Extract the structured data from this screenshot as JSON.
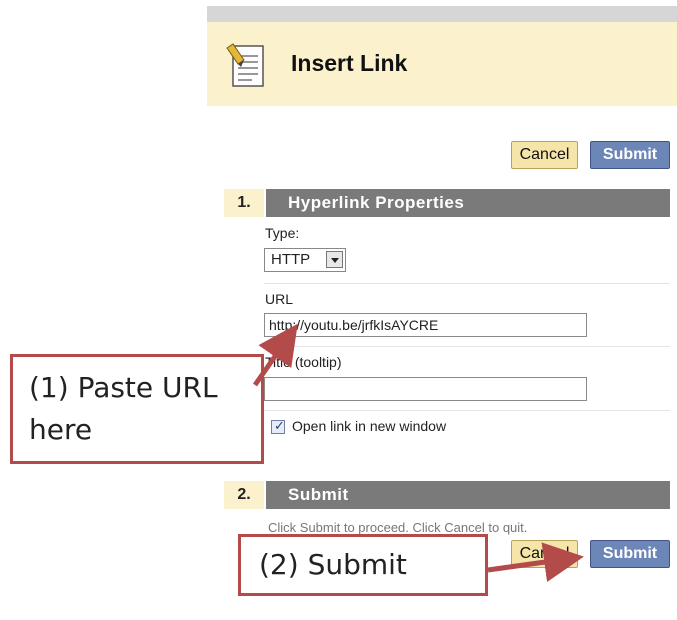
{
  "page": {
    "title": "Insert Link"
  },
  "actions": {
    "cancel_label": "Cancel",
    "submit_label": "Submit"
  },
  "section1": {
    "number": "1.",
    "title": "Hyperlink Properties",
    "type_label": "Type:",
    "type_value": "HTTP",
    "url_label": "URL",
    "url_value": "http://youtu.be/jrfkIsAYCRE",
    "title_label": "Title (tooltip)",
    "title_value": "",
    "open_new_window_label": "Open link in new window",
    "open_new_window_checked": true
  },
  "section2": {
    "number": "2.",
    "title": "Submit",
    "helper": "Click Submit to proceed. Click Cancel to quit."
  },
  "annotations": {
    "callout1": "(1) Paste URL here",
    "callout2": "(2) Submit",
    "color": "#b44b4b"
  },
  "colors": {
    "header_bg": "#fbf1cc",
    "section_bar": "#7a7a7a",
    "submit_bg": "#6d86b8",
    "cancel_bg": "#f6e5a9"
  },
  "icons": {
    "page": "document-pencil-icon",
    "dropdown": "chevron-down-icon",
    "checkbox": "checkmark-icon"
  }
}
